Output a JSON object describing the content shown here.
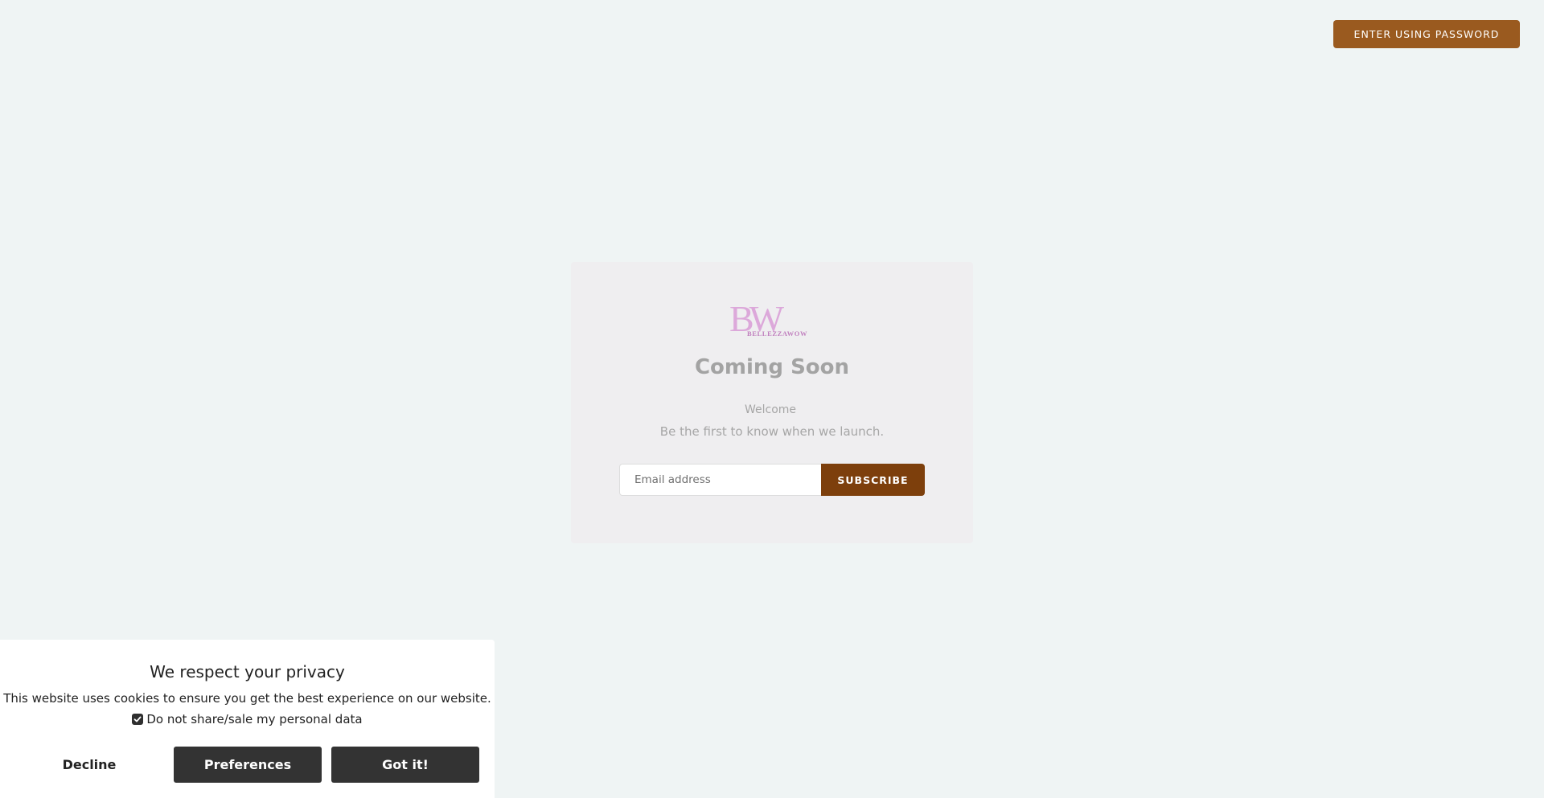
{
  "header": {
    "password_button_label": "ENTER USING PASSWORD"
  },
  "card": {
    "logo": {
      "icon": "bellezzawow-logo",
      "monogram": "BW",
      "wordmark": "BELLEZZAWOW"
    },
    "title": "Coming Soon",
    "welcome": "Welcome",
    "subtitle": "Be the first to know when we launch.",
    "email": {
      "placeholder": "Email address",
      "value": ""
    },
    "subscribe_label": "SUBSCRIBE"
  },
  "cookie_banner": {
    "title": "We respect your privacy",
    "text": "This website uses cookies to ensure you get the best experience on our website.",
    "optout_label": "Do not share/sale my personal data",
    "optout_checked": true,
    "decline_label": "Decline",
    "preferences_label": "Preferences",
    "gotit_label": "Got it!"
  },
  "colors": {
    "background": "#eff4f4",
    "accent": "#9a5a1f",
    "subscribe": "#7d3f0c",
    "logo": "#d8a3d6",
    "banner_button": "#333333"
  }
}
